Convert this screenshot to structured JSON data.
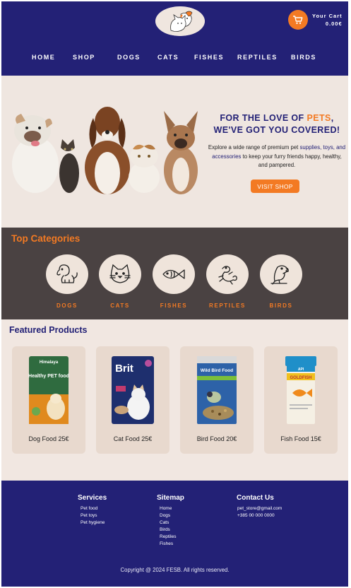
{
  "header": {
    "cart_label": "Your Cart",
    "cart_total": "0.00€",
    "nav": [
      "HOME",
      "SHOP",
      "DOGS",
      "CATS",
      "FISHES",
      "REPTILES",
      "BIRDS"
    ]
  },
  "hero": {
    "title_part1": "FOR THE LOVE OF ",
    "title_accent": "PETS",
    "title_part2": ",",
    "title_line2": "WE'VE GOT YOU COVERED!",
    "desc_part1": "Explore a wide range of premium pet ",
    "desc_accent": "supplies, toys, and accessories",
    "desc_part2": " to keep your furry friends happy, healthy, and pampered.",
    "cta": "VISIT SHOP"
  },
  "categories": {
    "title": "Top Categories",
    "items": [
      {
        "label": "DOGS",
        "icon": "dog-icon"
      },
      {
        "label": "CATS",
        "icon": "cat-icon"
      },
      {
        "label": "FISHES",
        "icon": "fish-icon"
      },
      {
        "label": "REPTILES",
        "icon": "reptile-icon"
      },
      {
        "label": "BIRDS",
        "icon": "bird-icon"
      }
    ]
  },
  "featured": {
    "title": "Featured Products",
    "products": [
      {
        "name": "Dog Food 25€",
        "pack_brand": "Himalaya",
        "pack_title": "Healthy PET food"
      },
      {
        "name": "Cat Food 25€",
        "pack_brand": "Brit",
        "pack_title": ""
      },
      {
        "name": "Bird Food 20€",
        "pack_brand": "",
        "pack_title": "Wild Bird Food"
      },
      {
        "name": "Fish Food 15€",
        "pack_brand": "API",
        "pack_title": "GOLDFISH"
      }
    ]
  },
  "footer": {
    "services_title": "Services",
    "services": [
      "Pet food",
      "Pet toys",
      "Pet hygiene"
    ],
    "sitemap_title": "Sitemap",
    "sitemap": [
      "Home",
      "Dogs",
      "Cats",
      "Birds",
      "Reptiles",
      "Fishes"
    ],
    "contact_title": "Contact Us",
    "contact": [
      "pet_store@gmail.com",
      "+385 00 000 0000"
    ],
    "copyright": "Copyright @ 2024 FESB. All rights reserved."
  },
  "colors": {
    "navy": "#232176",
    "orange": "#f37a23",
    "cream": "#f1e7e1",
    "dark": "#4a4242"
  }
}
